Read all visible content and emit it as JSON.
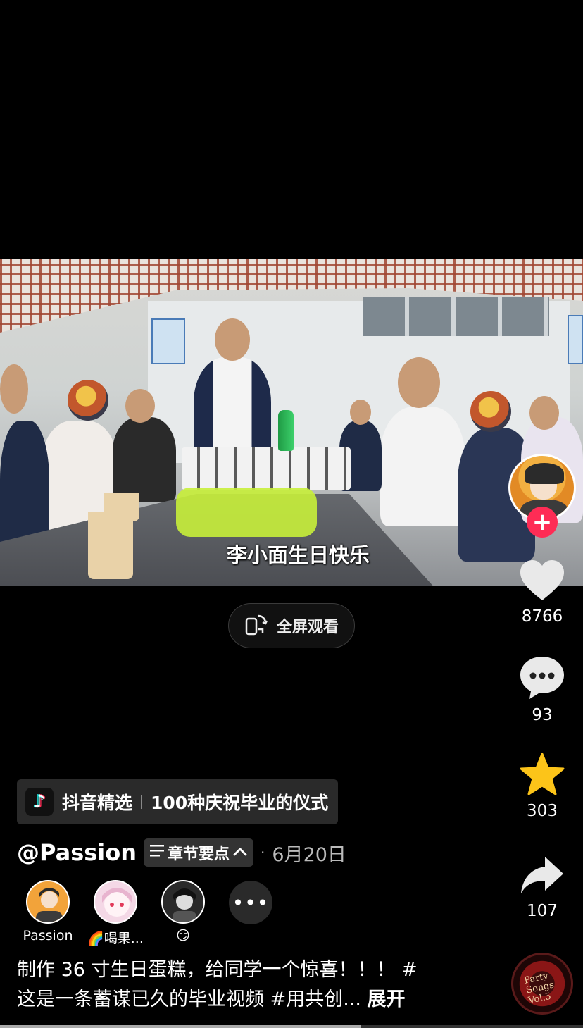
{
  "video": {
    "subtitle": "李小面生日快乐"
  },
  "fullscreen": {
    "label": "全屏观看"
  },
  "actions": {
    "likes": "8766",
    "comments": "93",
    "favorites": "303",
    "shares": "107"
  },
  "music_disc": {
    "text": "Party Songs Vol.5"
  },
  "collection": {
    "brand": "抖音精选",
    "title": "100种庆祝毕业的仪式"
  },
  "post": {
    "author": "@Passion",
    "chapter_label": "章节要点",
    "date": "6月20日"
  },
  "collaborators": [
    {
      "name": "Passion"
    },
    {
      "name": "🌈喝果..."
    },
    {
      "name": "😏"
    }
  ],
  "description": {
    "line1": "制作 36 寸生日蛋糕，给同学一个惊喜！！！ #",
    "line2": "这是一条蓄谋已久的毕业视频 #用共创...",
    "expand": "展开"
  },
  "progress_fraction": 0.62,
  "colors": {
    "accent_red": "#fe2c55",
    "star_yellow": "#fcc419",
    "background": "#000000"
  }
}
